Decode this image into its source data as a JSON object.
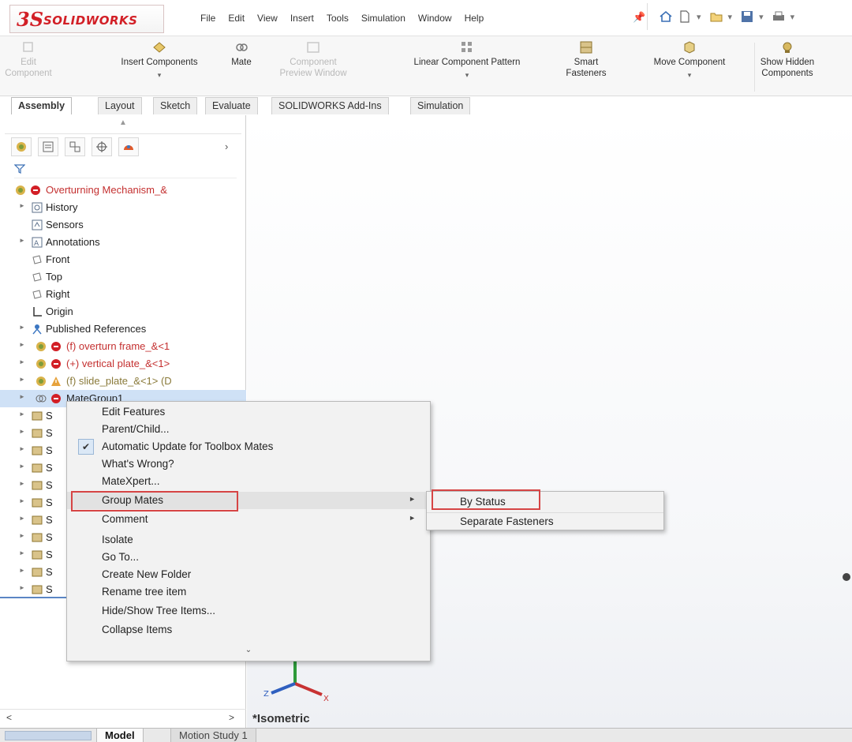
{
  "app": {
    "logo_text": "SOLIDWORKS",
    "menu": [
      "File",
      "Edit",
      "View",
      "Insert",
      "Tools",
      "Simulation",
      "Window",
      "Help"
    ]
  },
  "command_manager": {
    "buttons": [
      {
        "label": "Edit\nComponent",
        "icon": "edit-component-icon",
        "enabled": false
      },
      {
        "label": "Insert Components",
        "icon": "insert-components-icon",
        "enabled": true
      },
      {
        "label": "Mate",
        "icon": "mate-icon",
        "enabled": true
      },
      {
        "label": "Component\nPreview Window",
        "icon": "component-preview-icon",
        "enabled": false
      },
      {
        "label": "Linear Component Pattern",
        "icon": "linear-pattern-icon",
        "enabled": true
      },
      {
        "label": "Smart\nFasteners",
        "icon": "smart-fasteners-icon",
        "enabled": true
      },
      {
        "label": "Move Component",
        "icon": "move-component-icon",
        "enabled": true
      },
      {
        "label": "Show Hidden\nComponents",
        "icon": "show-hidden-icon",
        "enabled": true
      }
    ],
    "tabs": [
      "Assembly",
      "Layout",
      "Sketch",
      "Evaluate",
      "SOLIDWORKS Add-Ins",
      "Simulation"
    ],
    "active_tab": "Assembly"
  },
  "feature_tree": {
    "root": "Overturning Mechanism_&",
    "items": [
      {
        "label": "History",
        "icon": "history-icon",
        "expandable": true
      },
      {
        "label": "Sensors",
        "icon": "sensors-icon",
        "expandable": false
      },
      {
        "label": "Annotations",
        "icon": "annotations-icon",
        "expandable": true
      },
      {
        "label": "Front",
        "icon": "plane-icon",
        "expandable": false
      },
      {
        "label": "Top",
        "icon": "plane-icon",
        "expandable": false
      },
      {
        "label": "Right",
        "icon": "plane-icon",
        "expandable": false
      },
      {
        "label": "Origin",
        "icon": "origin-icon",
        "expandable": false
      },
      {
        "label": "Published References",
        "icon": "published-references-icon",
        "expandable": true
      },
      {
        "label": "(f) overturn frame_&<1",
        "icon": "part-error-icon",
        "expandable": true
      },
      {
        "label": "(+) vertical plate_&<1>",
        "icon": "part-error-icon",
        "expandable": true
      },
      {
        "label": "(f) slide_plate_&<1> (D",
        "icon": "part-warning-icon",
        "expandable": true
      },
      {
        "label": "MateGroup1",
        "icon": "mategroup-icon",
        "expandable": true
      }
    ],
    "mate_rows": [
      "S",
      "S",
      "S",
      "S",
      "S",
      "S",
      "S",
      "S",
      "S",
      "S",
      "S"
    ]
  },
  "context_menu": {
    "items": [
      {
        "label": "Edit Features",
        "checked": false,
        "submenu": false
      },
      {
        "label": "Parent/Child...",
        "checked": false,
        "submenu": false
      },
      {
        "label": "Automatic Update for Toolbox Mates",
        "checked": true,
        "submenu": false
      },
      {
        "label": "What's Wrong?",
        "checked": false,
        "submenu": false
      },
      {
        "label": "MateXpert...",
        "checked": false,
        "submenu": false
      },
      {
        "label": "Group Mates",
        "checked": false,
        "submenu": true
      },
      {
        "label": "Comment",
        "checked": false,
        "submenu": true
      },
      {
        "label": "Isolate",
        "checked": false,
        "submenu": false
      },
      {
        "label": "Go To...",
        "checked": false,
        "submenu": false
      },
      {
        "label": "Create New Folder",
        "checked": false,
        "submenu": false
      },
      {
        "label": "Rename tree item",
        "checked": false,
        "submenu": false
      },
      {
        "label": "Hide/Show Tree Items...",
        "checked": false,
        "submenu": false
      },
      {
        "label": "Collapse Items",
        "checked": false,
        "submenu": false
      }
    ],
    "more_glyph": "⌄",
    "submenu": [
      "By Status",
      "Separate Fasteners"
    ],
    "highlighted": [
      "Group Mates",
      "By Status"
    ]
  },
  "graphics": {
    "view_name": "*Isometric",
    "triad_labels": [
      "Z",
      "X"
    ]
  },
  "bottom_tabs": [
    "Model",
    "Motion Study 1"
  ],
  "active_bottom_tab": "Model",
  "colors": {
    "brand_red": "#d21f26",
    "highlight_box": "#d64545",
    "error_text": "#c43030",
    "selection": "#cfe1f6"
  }
}
